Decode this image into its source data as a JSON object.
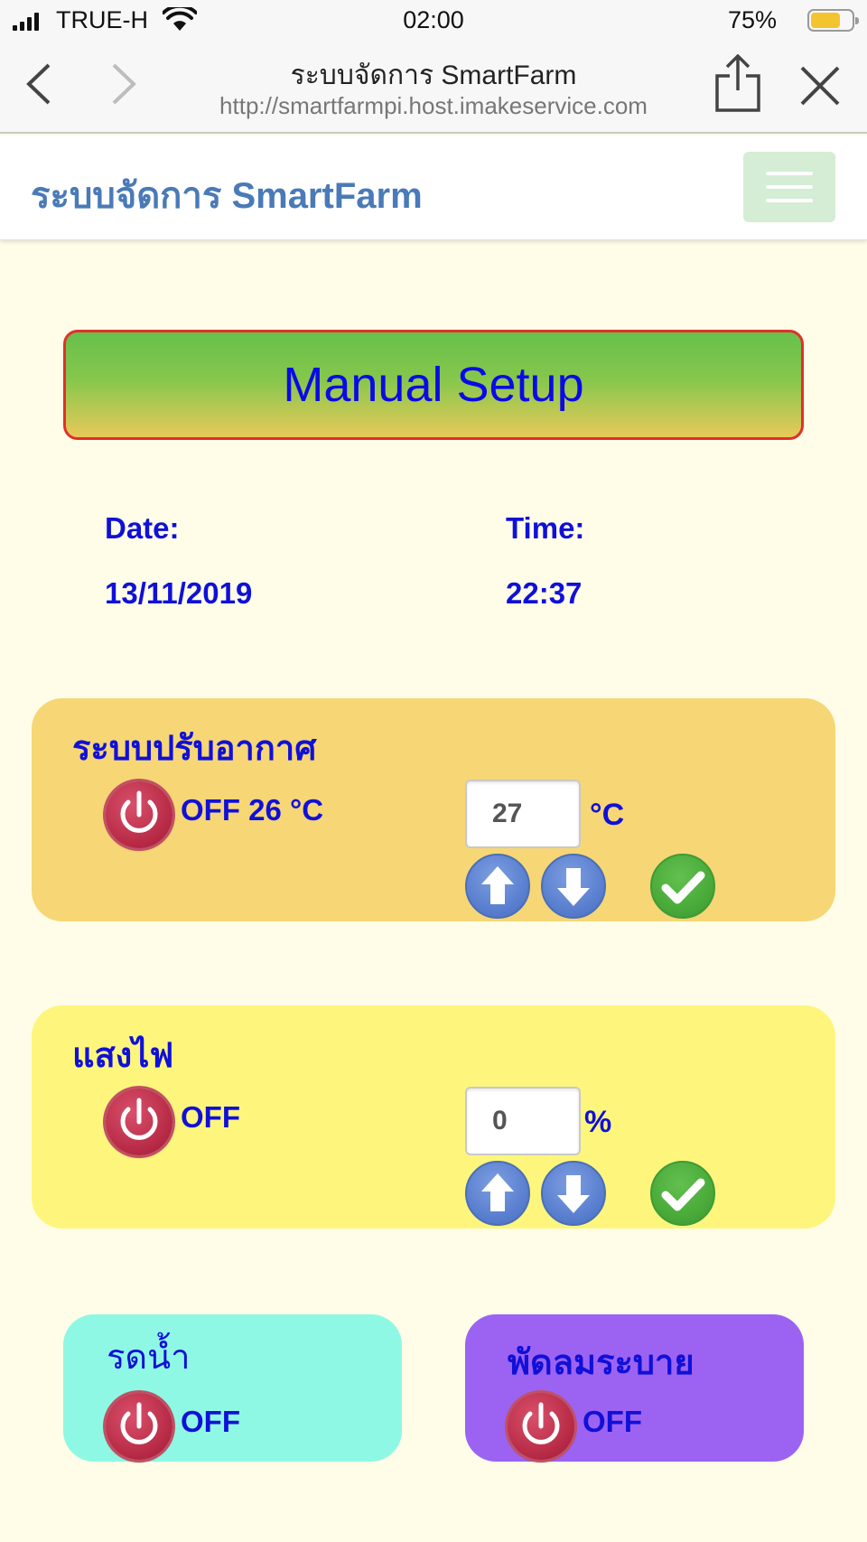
{
  "status_bar": {
    "carrier": "TRUE-H",
    "time": "02:00",
    "battery_percent": "75%"
  },
  "browser": {
    "page_title": "ระบบจัดการ SmartFarm",
    "url": "http://smartfarmpi.host.imakeservice.com"
  },
  "app": {
    "brand": "ระบบจัดการ SmartFarm",
    "banner": "Manual Setup",
    "date_label": "Date:",
    "date_value": "13/11/2019",
    "time_label": "Time:",
    "time_value": "22:37"
  },
  "air_conditioner": {
    "title": "ระบบปรับอากาศ",
    "status": "OFF 26 °C",
    "setpoint": "27",
    "unit": "°C"
  },
  "lighting": {
    "title": "แสงไฟ",
    "status": "OFF",
    "setpoint": "0",
    "unit": "%"
  },
  "watering": {
    "title": "รดน้ำ",
    "status": "OFF"
  },
  "exhaust_fan": {
    "title": "พัดลมระบาย",
    "status": "OFF"
  },
  "colors": {
    "air_panel": "#f7d675",
    "light_panel": "#fef67c",
    "water_panel": "#8ff8e4",
    "fan_panel": "#9c63f2",
    "text_blue": "#1010d8"
  }
}
